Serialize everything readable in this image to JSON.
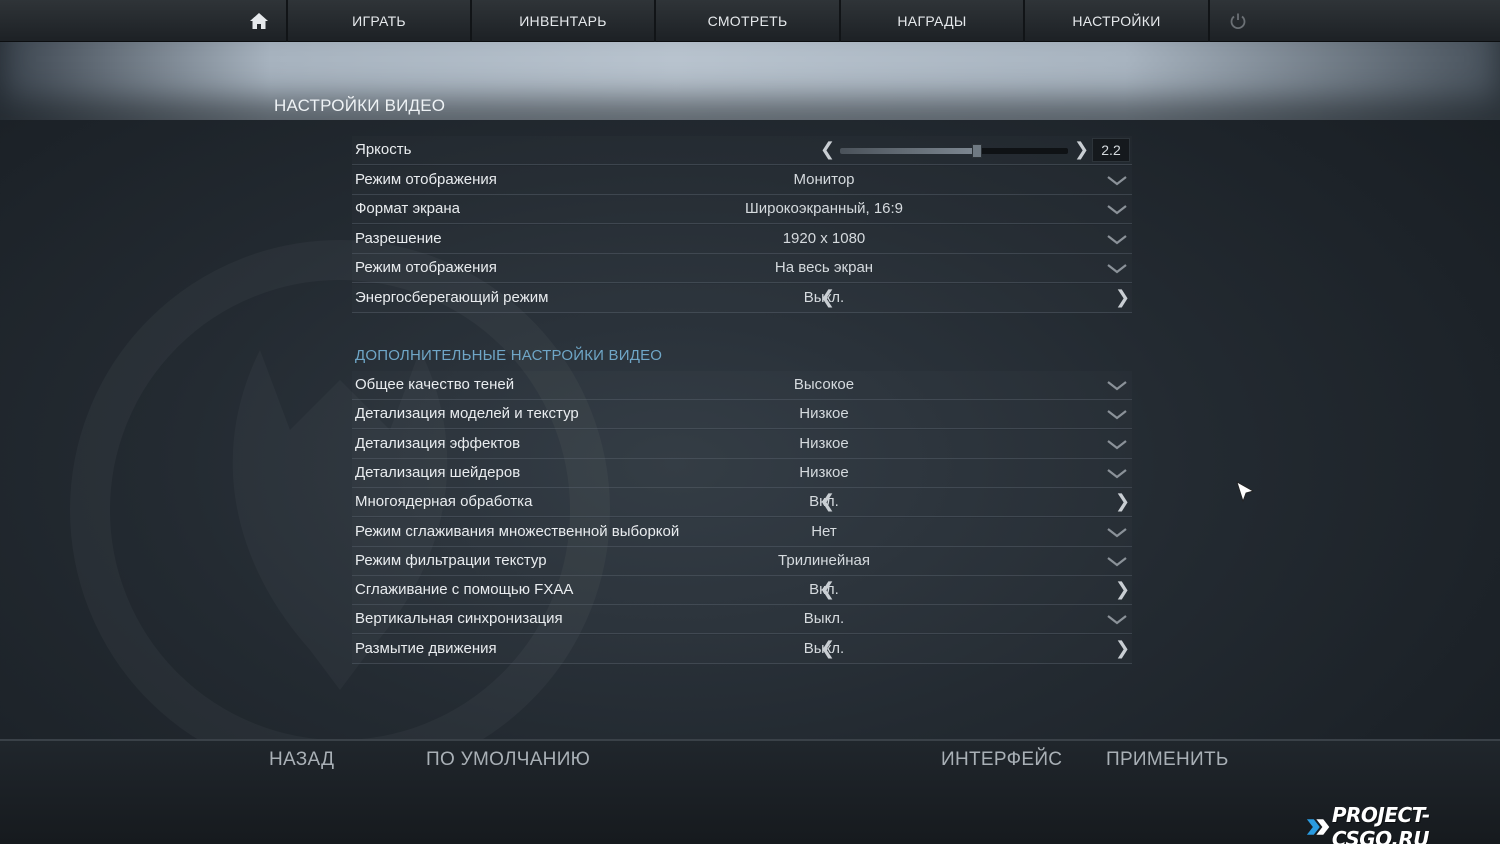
{
  "nav": {
    "items": [
      {
        "label": "ИГРАТЬ"
      },
      {
        "label": "ИНВЕНТАРЬ"
      },
      {
        "label": "СМОТРЕТЬ"
      },
      {
        "label": "НАГРАДЫ"
      },
      {
        "label": "НАСТРОЙКИ"
      }
    ],
    "icons": {
      "home": "home-icon",
      "power": "power-icon"
    }
  },
  "page_title": "НАСТРОЙКИ ВИДЕО",
  "basic": {
    "brightness": {
      "label": "Яркость",
      "value": "2.2",
      "level": 0.6
    },
    "rows": [
      {
        "label": "Режим отображения",
        "value": "Монитор",
        "control": "dropdown"
      },
      {
        "label": "Формат экрана",
        "value": "Широкоэкранный, 16:9",
        "control": "dropdown"
      },
      {
        "label": "Разрешение",
        "value": "1920 x 1080",
        "control": "dropdown"
      },
      {
        "label": "Режим отображения",
        "value": "На весь экран",
        "control": "dropdown"
      },
      {
        "label": "Энергосберегающий режим",
        "value": "Выкл.",
        "control": "arrows"
      }
    ]
  },
  "advanced": {
    "title": "ДОПОЛНИТЕЛЬНЫЕ НАСТРОЙКИ ВИДЕО",
    "rows": [
      {
        "label": "Общее качество теней",
        "value": "Высокое",
        "control": "dropdown"
      },
      {
        "label": "Детализация моделей и текстур",
        "value": "Низкое",
        "control": "dropdown"
      },
      {
        "label": "Детализация эффектов",
        "value": "Низкое",
        "control": "dropdown"
      },
      {
        "label": "Детализация шейдеров",
        "value": "Низкое",
        "control": "dropdown"
      },
      {
        "label": "Многоядерная обработка",
        "value": "Вкл.",
        "control": "arrows"
      },
      {
        "label": "Режим сглаживания множественной выборкой",
        "value": "Нет",
        "control": "dropdown"
      },
      {
        "label": "Режим фильтрации текстур",
        "value": "Трилинейная",
        "control": "dropdown"
      },
      {
        "label": "Сглаживание с помощью FXAA",
        "value": "Вкл.",
        "control": "arrows"
      },
      {
        "label": "Вертикальная синхронизация",
        "value": "Выкл.",
        "control": "dropdown"
      },
      {
        "label": "Размытие движения",
        "value": "Выкл.",
        "control": "arrows"
      }
    ]
  },
  "bottom": {
    "back": "НАЗАД",
    "default": "ПО УМОЛЧАНИЮ",
    "interface": "ИНТЕРФЕЙС",
    "apply": "ПРИМЕНИТЬ"
  },
  "watermark": "PROJECT-CSGO.RU",
  "colors": {
    "accent_section": "#6fa6c7",
    "text": "#e9ecef",
    "nav_bg": "#2a2f33"
  }
}
